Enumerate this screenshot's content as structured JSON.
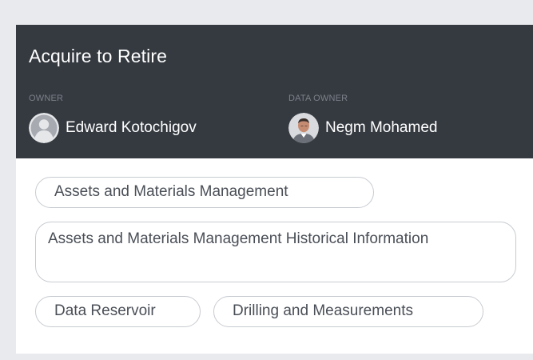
{
  "card": {
    "title": "Acquire to Retire",
    "owner": {
      "label": "OWNER",
      "name": "Edward Kotochigov",
      "avatar_icon": "default-user-avatar-icon"
    },
    "data_owner": {
      "label": "DATA OWNER",
      "name": "Negm Mohamed",
      "avatar_icon": "user-photo-avatar"
    },
    "tags": [
      "Assets and Materials Management",
      "Assets and Materials Management Historical Information",
      "Data Reservoir",
      "Drilling and Measurements"
    ]
  },
  "colors": {
    "page_background": "#e9eaed",
    "header_background": "#353a41",
    "label_muted": "#7b8089",
    "tag_border": "#c7cbd1",
    "tag_text": "#4a4f57"
  }
}
